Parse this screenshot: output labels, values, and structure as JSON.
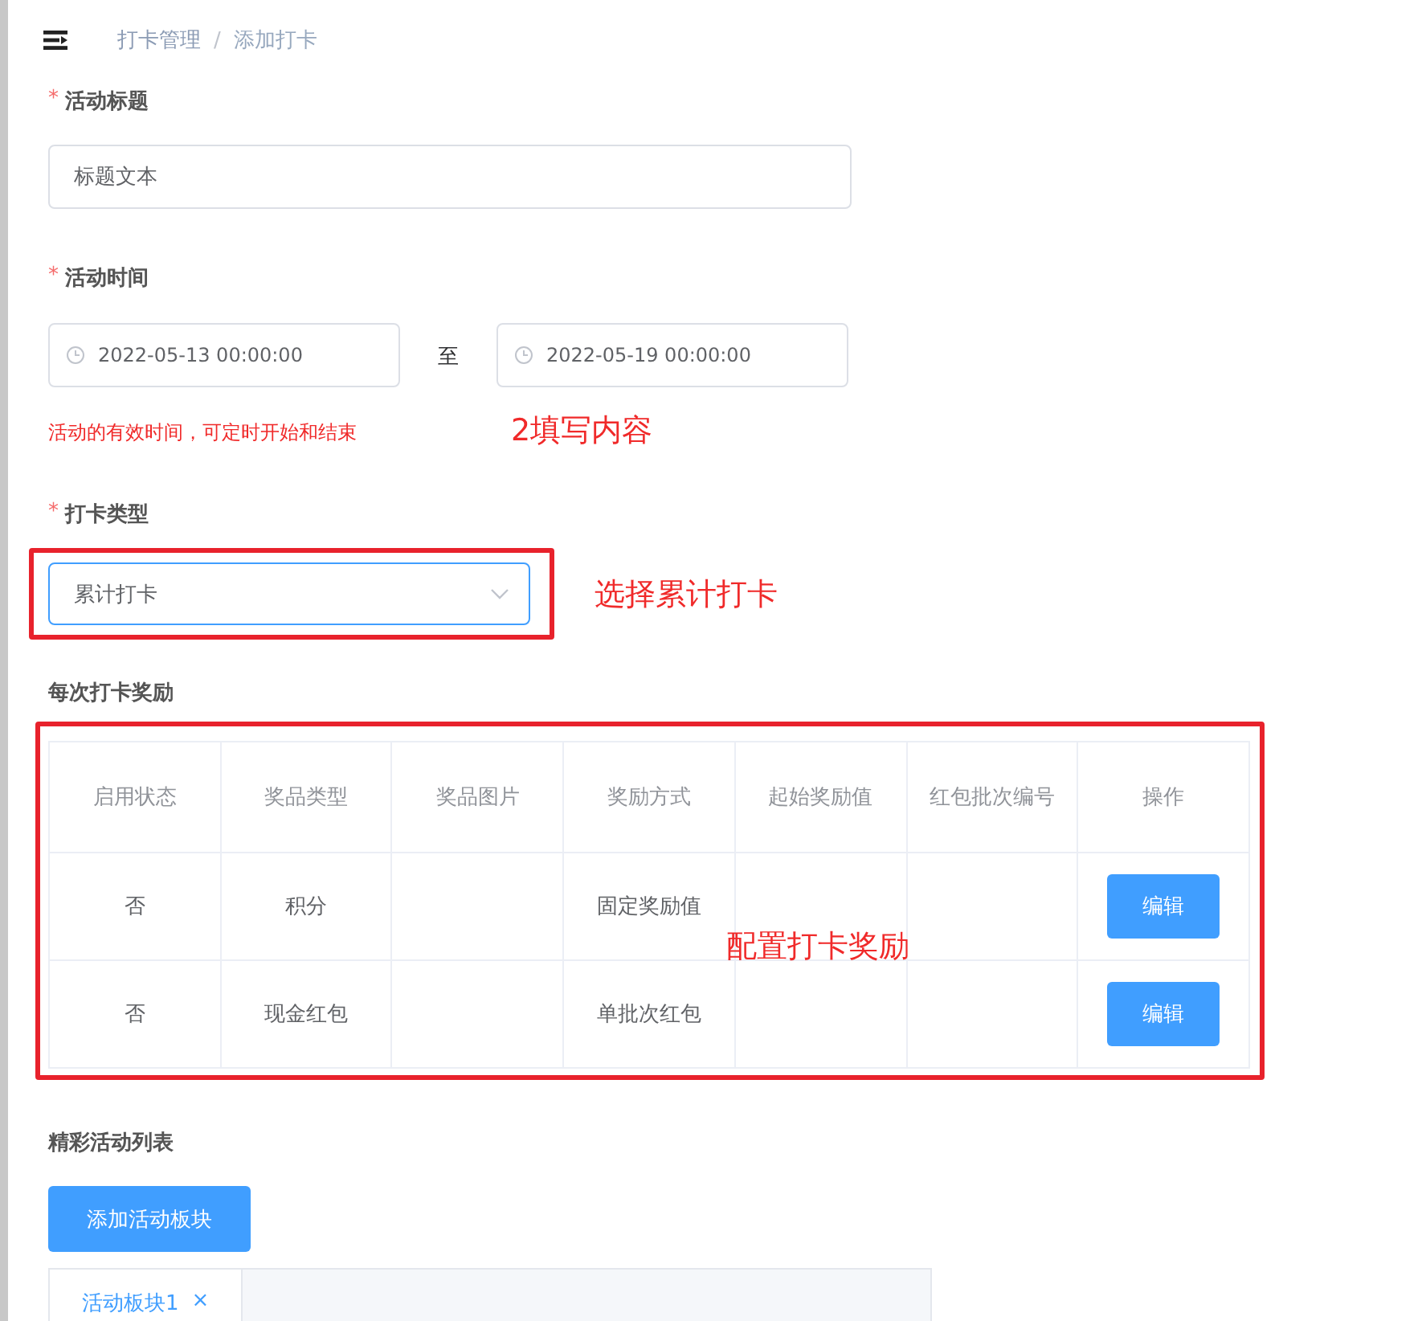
{
  "breadcrumb": [
    "打卡管理",
    "添加打卡"
  ],
  "breadcrumb_separator": "/",
  "title_field": {
    "label": "活动标题",
    "required": "*",
    "value": "标题文本"
  },
  "time_field": {
    "label": "活动时间",
    "required": "*",
    "start": "2022-05-13 00:00:00",
    "separator": "至",
    "end": "2022-05-19 00:00:00",
    "hint": "活动的有效时间，可定时开始和结束",
    "annotation": "2填写内容"
  },
  "type_field": {
    "label": "打卡类型",
    "required": "*",
    "value": "累计打卡",
    "annotation": "选择累计打卡"
  },
  "rewards": {
    "title": "每次打卡奖励",
    "annotation": "配置打卡奖励",
    "columns": [
      "启用状态",
      "奖品类型",
      "奖品图片",
      "奖励方式",
      "起始奖励值",
      "红包批次编号",
      "操作"
    ],
    "rows": [
      {
        "cells": [
          "否",
          "积分",
          "",
          "固定奖励值",
          ""
        ],
        "action": "编辑"
      },
      {
        "cells": [
          "否",
          "现金红包",
          "",
          "单批次红包",
          ""
        ],
        "action": "编辑"
      }
    ]
  },
  "activities": {
    "title": "精彩活动列表",
    "add_button": "添加活动板块",
    "tabs": [
      {
        "label": "活动板块1",
        "selected": true,
        "closable": "×"
      }
    ]
  }
}
